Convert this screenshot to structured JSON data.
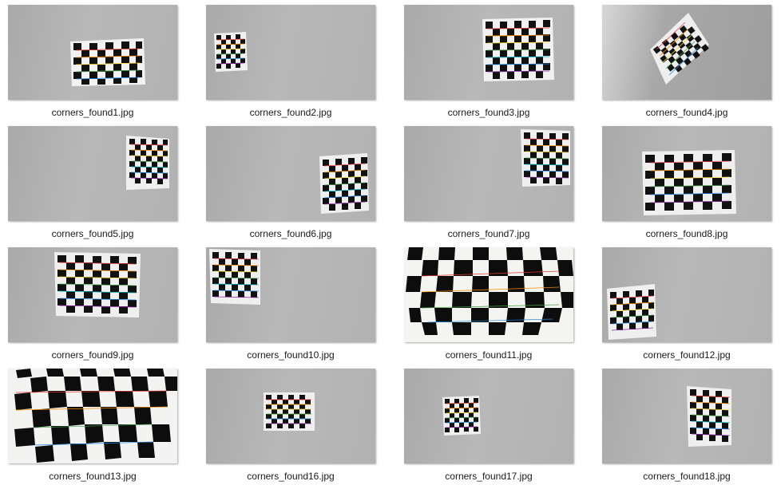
{
  "files": [
    {
      "name": "corners_found1.jpg"
    },
    {
      "name": "corners_found2.jpg"
    },
    {
      "name": "corners_found3.jpg"
    },
    {
      "name": "corners_found4.jpg"
    },
    {
      "name": "corners_found5.jpg"
    },
    {
      "name": "corners_found6.jpg"
    },
    {
      "name": "corners_found7.jpg"
    },
    {
      "name": "corners_found8.jpg"
    },
    {
      "name": "corners_found9.jpg"
    },
    {
      "name": "corners_found10.jpg"
    },
    {
      "name": "corners_found11.jpg"
    },
    {
      "name": "corners_found12.jpg"
    },
    {
      "name": "corners_found13.jpg"
    },
    {
      "name": "corners_found16.jpg"
    },
    {
      "name": "corners_found17.jpg"
    },
    {
      "name": "corners_found18.jpg"
    }
  ]
}
